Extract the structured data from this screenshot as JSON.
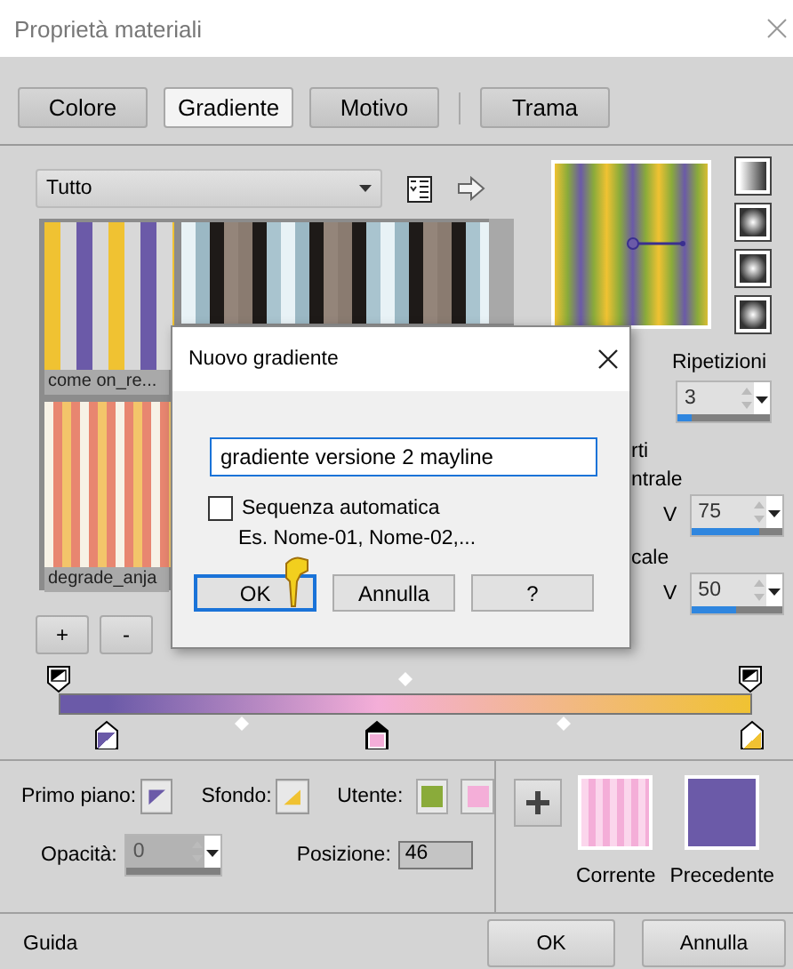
{
  "window": {
    "title": "Proprietà materiali"
  },
  "tabs": [
    {
      "label": "Colore",
      "selected": false
    },
    {
      "label": "Gradiente",
      "selected": true
    },
    {
      "label": "Motivo",
      "selected": false
    },
    {
      "label": "Trama",
      "selected": false
    }
  ],
  "library": {
    "filter": "Tutto",
    "items": [
      {
        "name": "come on_re..."
      },
      {
        "name": "degrade_anja"
      }
    ]
  },
  "list_buttons": [
    "+",
    "-"
  ],
  "repeats": {
    "label": "Ripetizioni",
    "value": "3",
    "level": 0.15
  },
  "partial_labels": [
    "rti",
    "ntrale",
    "cale"
  ],
  "spinners": [
    {
      "label": "V",
      "value": "75",
      "level": 0.75
    },
    {
      "label": "V",
      "value": "50",
      "level": 0.5
    }
  ],
  "stops": [
    {
      "kind": "foreground",
      "color": "#6b5aa8",
      "selected": false
    },
    {
      "kind": "user",
      "color": "#f4aed8",
      "selected": true
    },
    {
      "kind": "background",
      "color": "#f0c232",
      "selected": false
    }
  ],
  "foreground": {
    "label": "Primo piano:"
  },
  "background": {
    "label": "Sfondo:"
  },
  "user": {
    "label": "Utente:",
    "swatches": [
      {
        "color": "#8aab3a"
      },
      {
        "color": "#f4aed8"
      }
    ]
  },
  "opacity": {
    "label": "Opacità:",
    "value": "0",
    "disabled": true
  },
  "position": {
    "label": "Posizione:",
    "value": "46"
  },
  "current": {
    "label": "Corrente"
  },
  "previous": {
    "label": "Precedente"
  },
  "footer": {
    "help": "Guida",
    "buttons": [
      {
        "label": "OK"
      },
      {
        "label": "Annulla"
      }
    ]
  },
  "dialog": {
    "title": "Nuovo gradiente",
    "name_value": "gradiente versione 2 mayline",
    "checkbox": {
      "label": "Sequenza automatica",
      "checked": false
    },
    "hint": "Es. Nome-01, Nome-02,...",
    "buttons": [
      {
        "label": "OK",
        "default": true
      },
      {
        "label": "Annulla",
        "default": false
      },
      {
        "label": "?",
        "default": false
      }
    ]
  }
}
